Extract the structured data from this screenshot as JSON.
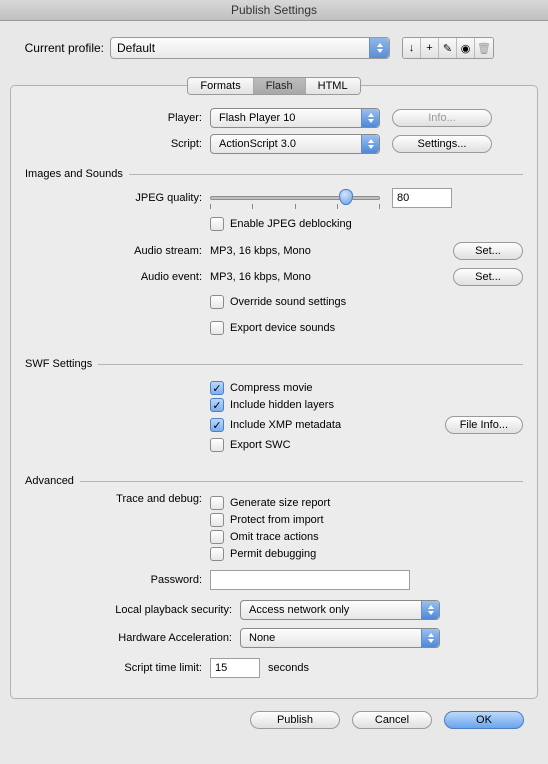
{
  "window_title": "Publish Settings",
  "profile_label": "Current profile:",
  "profile_value": "Default",
  "toolbar_icons": [
    "↓",
    "+",
    "✎",
    "◉",
    "🗑"
  ],
  "tabs": {
    "formats": "Formats",
    "flash": "Flash",
    "html": "HTML"
  },
  "player": {
    "label": "Player:",
    "value": "Flash Player 10",
    "info_btn": "Info..."
  },
  "script": {
    "label": "Script:",
    "value": "ActionScript 3.0",
    "settings_btn": "Settings..."
  },
  "images_sounds": {
    "legend": "Images and Sounds",
    "jpeg_quality_label": "JPEG quality:",
    "jpeg_quality_value": "80",
    "jpeg_deblocking": "Enable JPEG deblocking",
    "audio_stream_label": "Audio stream:",
    "audio_stream_value": "MP3, 16 kbps, Mono",
    "audio_event_label": "Audio event:",
    "audio_event_value": "MP3, 16 kbps, Mono",
    "set_btn": "Set...",
    "override": "Override sound settings",
    "export_device": "Export device sounds"
  },
  "swf": {
    "legend": "SWF Settings",
    "compress": "Compress movie",
    "hidden": "Include hidden layers",
    "xmp": "Include XMP metadata",
    "export_swc": "Export SWC",
    "file_info_btn": "File Info..."
  },
  "advanced": {
    "legend": "Advanced",
    "trace_label": "Trace and debug:",
    "size_report": "Generate size report",
    "protect": "Protect from import",
    "omit": "Omit trace actions",
    "permit": "Permit debugging",
    "password_label": "Password:",
    "password_value": "",
    "local_label": "Local playback security:",
    "local_value": "Access network only",
    "hardware_label": "Hardware Acceleration:",
    "hardware_value": "None",
    "timelimit_label": "Script time limit:",
    "timelimit_value": "15",
    "timelimit_unit": "seconds"
  },
  "buttons": {
    "publish": "Publish",
    "cancel": "Cancel",
    "ok": "OK"
  }
}
